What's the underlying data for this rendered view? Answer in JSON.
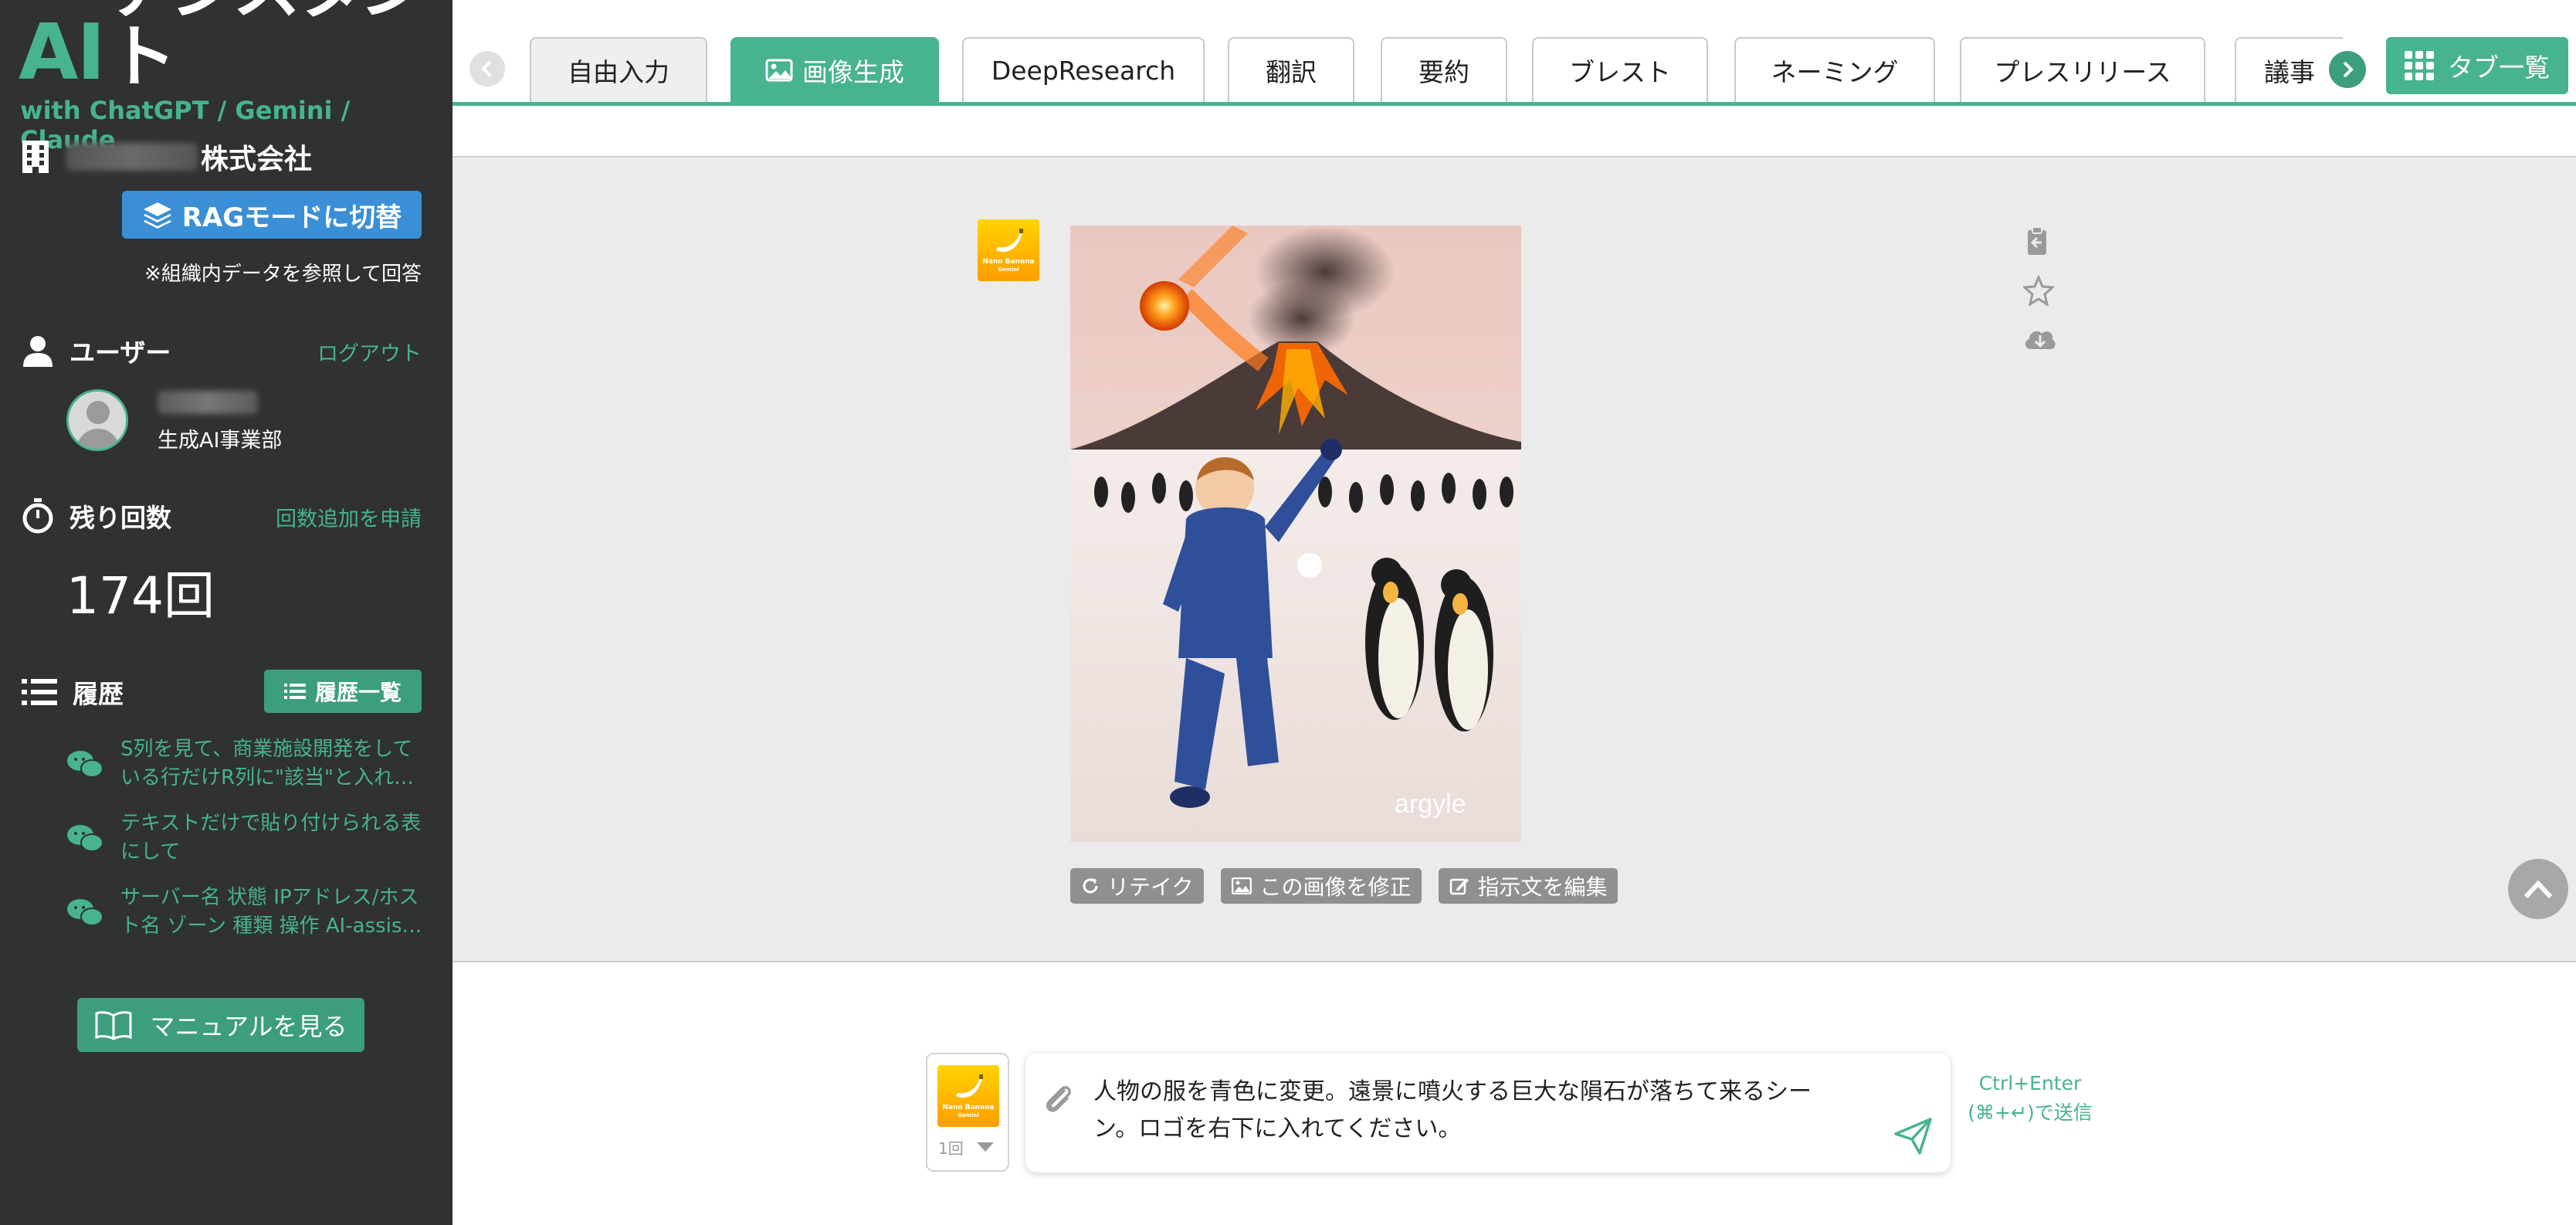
{
  "sidebar": {
    "logo_ai": "AI",
    "logo_jp": "アシスタント",
    "logo_sub": "with ChatGPT / Gemini / Claude",
    "company_suffix": "株式会社",
    "rag_button": "RAGモードに切替",
    "rag_note": "※組織内データを参照して回答",
    "user_section": {
      "title": "ユーザー",
      "logout": "ログアウト",
      "department": "生成AI事業部"
    },
    "remaining": {
      "title": "残り回数",
      "request_link": "回数追加を申請",
      "count": "174回"
    },
    "history": {
      "title": "履歴",
      "list_button": "履歴一覧",
      "items": [
        {
          "line1": "S列を見て、商業施設開発をして",
          "line2": "いる行だけR列に\"該当\"と入れ…"
        },
        {
          "line1": "テキストだけで貼り付けられる表",
          "line2": "にして"
        },
        {
          "line1": "サーバー名 状態 IPアドレス/ホス",
          "line2": "ト名 ゾーン 種類 操作 AI-assis…"
        }
      ]
    },
    "manual_button": "マニュアルを見る"
  },
  "tabs": [
    {
      "label": "自由入力"
    },
    {
      "label": "画像生成"
    },
    {
      "label": "DeepResearch"
    },
    {
      "label": "翻訳"
    },
    {
      "label": "要約"
    },
    {
      "label": "ブレスト"
    },
    {
      "label": "ネーミング"
    },
    {
      "label": "プレスリリース"
    },
    {
      "label": "議事"
    }
  ],
  "tab_list_button": "タブ一覧",
  "bot_badge": {
    "label": "Nano Banana",
    "sub": "Gemini"
  },
  "image": {
    "watermark": "argyle"
  },
  "image_actions": {
    "retake": "リテイク",
    "edit_image": "この画像を修正",
    "edit_prompt": "指示文を編集"
  },
  "input": {
    "model_count": "1回",
    "prompt_line1": "人物の服を青色に変更。遠景に噴火する巨大な隕石が落ちて来るシー",
    "prompt_line2": "ン。ロゴを右下に入れてください。",
    "send_hint_line1": "Ctrl+Enter",
    "send_hint_line2": "(⌘+↵)で送信"
  },
  "colors": {
    "accent": "#47b38f",
    "accent_dark": "#3c9e7c",
    "sidebar_bg": "#2f3133",
    "rag_blue": "#3a8fd6",
    "content_bg": "#ebebeb"
  }
}
